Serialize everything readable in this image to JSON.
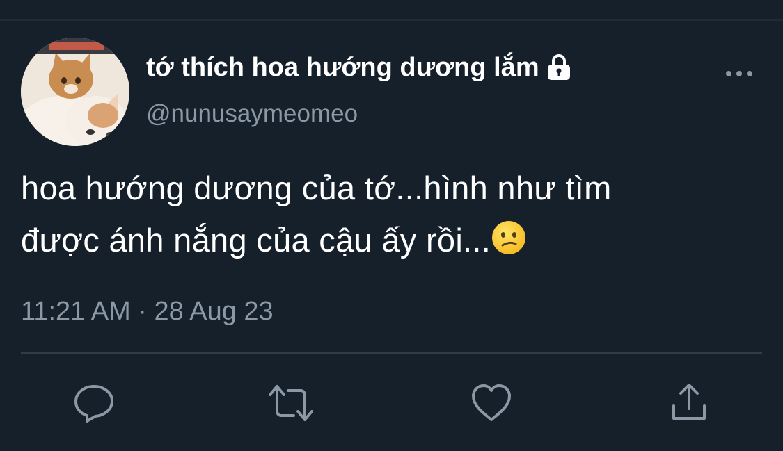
{
  "tweet": {
    "author": {
      "display_name": "tớ thích hoa hướng dương lắm",
      "handle": "@nunusaymeomeo",
      "protected_icon": "lock-icon",
      "avatar": "cat-avatar"
    },
    "text_line1": "hoa hướng dương của tớ...hình như tìm",
    "text_line2": "được ánh nắng của cậu ấy rồi...",
    "emoji": "confused-face-emoji",
    "timestamp": "11:21 AM · 28 Aug 23",
    "actions": [
      "reply-icon",
      "retweet-icon",
      "like-icon",
      "share-icon"
    ]
  },
  "colors": {
    "background": "#15202b",
    "primary_text": "#ffffff",
    "secondary_text": "#8b98a5",
    "divider": "#2f3c4a",
    "icon": "#8b98a5"
  }
}
